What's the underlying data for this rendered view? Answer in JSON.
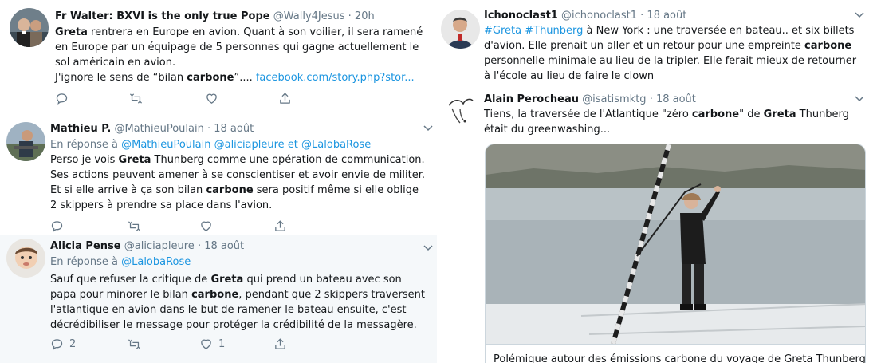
{
  "left_tweets": [
    {
      "name": "Fr Walter: BXVI is the only true Pope",
      "handle": "@Wally4Jesus",
      "time": "· 20h",
      "text_html": "<b>Greta</b> rentrera en Europe en avion. Quant à son voilier, il sera ramené en Europe par un équipage de 5 personnes qui gagne actuellement le sol américain en avion.<br>J'ignore le sens de “bilan <b>carbone</b>”.... <span class=\"link\">facebook.com/story.php?stor...</span>",
      "replies": "",
      "retweets": "",
      "likes": ""
    },
    {
      "name": "Mathieu P.",
      "handle": "@MathieuPoulain",
      "time": "· 18 août",
      "reply_prefix": "En réponse à",
      "reply_to": "@MathieuPoulain @aliciapleure  et  @LalobaRose",
      "text_html": "Perso je vois <b>Greta</b> Thunberg comme une opération de communication. Ses actions peuvent amener à se conscientiser et avoir envie de militer. Et si elle arrive à ça son bilan <b>carbone</b> sera positif même si elle oblige 2 skippers à prendre sa place dans l'avion.",
      "replies": "",
      "retweets": "",
      "likes": ""
    },
    {
      "name": "Alicia Pense",
      "handle": "@aliciapleure",
      "time": "· 18 août",
      "reply_prefix": "En réponse à",
      "reply_to": "@LalobaRose",
      "text_html": "Sauf que refuser la critique de <b>Greta</b> qui prend un bateau avec son papa pour minorer le bilan <b>carbone</b>, pendant que 2 skippers traversent l'atlantique en avion dans le but de ramener le bateau ensuite, c'est décrédibiliser le message pour protéger la crédibilité de la messagère.",
      "replies": "2",
      "retweets": "",
      "likes": "1"
    }
  ],
  "right_tweets": [
    {
      "name": "Ichonoclast1",
      "handle": "@ichonoclast1",
      "time": "· 18 août",
      "text_html": "<span class=\"link\">#Greta</span> <span class=\"link\">#Thunberg</span> à New York : une traversée en bateau.. et six billets d'avion.  Elle prenait un aller et un retour pour une empreinte <b>carbone</b> personnelle minimale au lieu de la  tripler. Elle ferait mieux de retourner à l'école au lieu de faire le clown"
    },
    {
      "name": "Alain Perocheau",
      "handle": "@isatismktg",
      "time": "· 18 août",
      "text_html": "Tiens, la traversée de l'Atlantique \"zéro <b>carbone</b>\" de <b>Greta</b> Thunberg était du greenwashing...",
      "card_caption": "Polémique autour des émissions carbone du voyage de Greta Thunberg"
    }
  ],
  "colors": {
    "link": "#1b95e0",
    "muted": "#657786",
    "text": "#14171a",
    "shaded_bg": "#f5f8fa"
  }
}
